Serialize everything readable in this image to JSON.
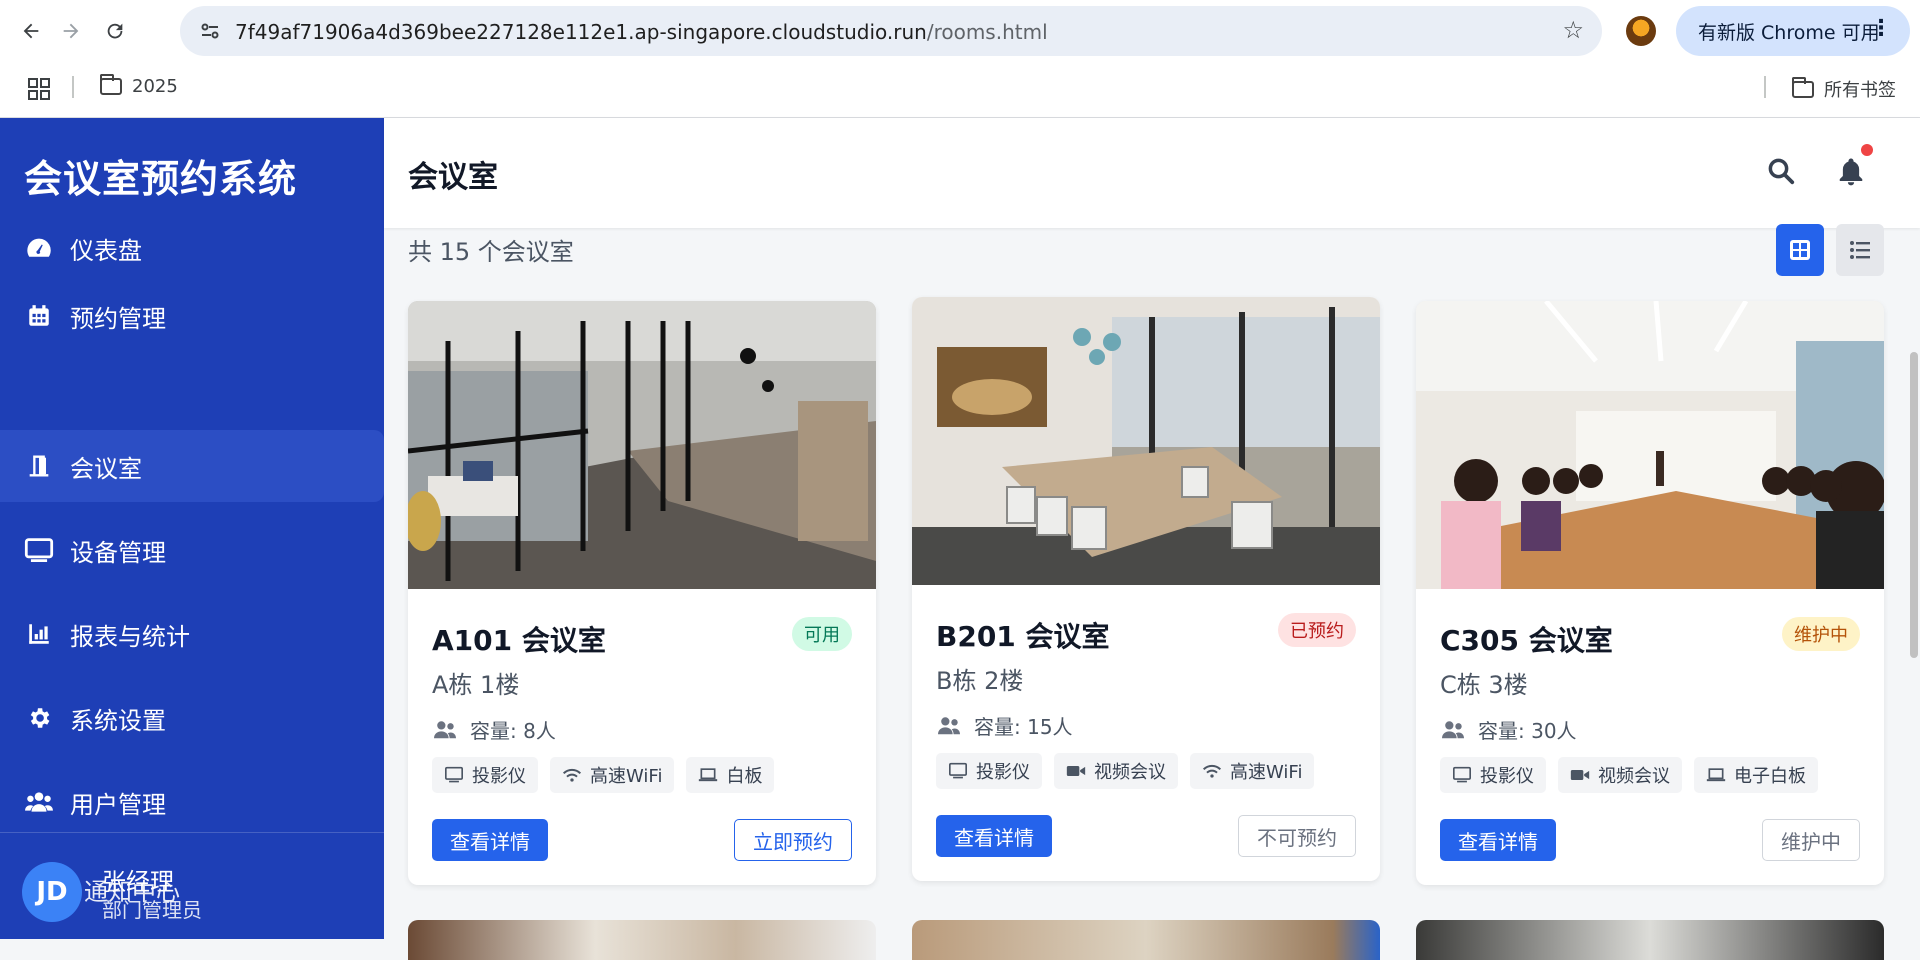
{
  "browser": {
    "url_main": "7f49af71906a4d369bee227128e112e1.ap-singapore.cloudstudio.run",
    "url_path": "/rooms.html",
    "update_label": "有新版 Chrome 可用",
    "bookmark_folder": "2025",
    "all_bookmarks": "所有书签"
  },
  "sidebar": {
    "brand": "会议室预约系统",
    "items": [
      {
        "label": "仪表盘",
        "icon": "gauge-icon"
      },
      {
        "label": "预约管理",
        "icon": "calendar-icon"
      },
      {
        "label": "会议室",
        "icon": "door-icon"
      },
      {
        "label": "设备管理",
        "icon": "monitor-icon"
      },
      {
        "label": "报表与统计",
        "icon": "bar-chart-icon"
      },
      {
        "label": "系统设置",
        "icon": "gear-icon"
      },
      {
        "label": "用户管理",
        "icon": "users-icon"
      }
    ],
    "active_index": 2,
    "user": {
      "initials": "JD",
      "name": "张经理",
      "role": "部门管理员",
      "overlap_text": "通知中心"
    }
  },
  "header": {
    "title": "会议室"
  },
  "main": {
    "count_text": "共 15 个会议室",
    "rooms": [
      {
        "title": "A101 会议室",
        "status": "可用",
        "location": "A栋 1楼",
        "capacity": "容量: 8人",
        "features": [
          {
            "label": "投影仪",
            "icon": "monitor-icon"
          },
          {
            "label": "高速WiFi",
            "icon": "wifi-icon"
          },
          {
            "label": "白板",
            "icon": "laptop-icon"
          }
        ],
        "detail_label": "查看详情",
        "action_label": "立即预约"
      },
      {
        "title": "B201 会议室",
        "status": "已预约",
        "location": "B栋 2楼",
        "capacity": "容量: 15人",
        "features": [
          {
            "label": "投影仪",
            "icon": "monitor-icon"
          },
          {
            "label": "视频会议",
            "icon": "video-icon"
          },
          {
            "label": "高速WiFi",
            "icon": "wifi-icon"
          }
        ],
        "detail_label": "查看详情",
        "action_label": "不可预约"
      },
      {
        "title": "C305 会议室",
        "status": "维护中",
        "location": "C栋 3楼",
        "capacity": "容量: 30人",
        "features": [
          {
            "label": "投影仪",
            "icon": "monitor-icon"
          },
          {
            "label": "视频会议",
            "icon": "video-icon"
          },
          {
            "label": "电子白板",
            "icon": "laptop-icon"
          }
        ],
        "detail_label": "查看详情",
        "action_label": "维护中"
      }
    ]
  },
  "colors": {
    "sidebar": "#1e3fb6",
    "primary": "#2563eb",
    "ok_bg": "#d1fae5",
    "booked_bg": "#fee2e2",
    "maint_bg": "#fef3c7"
  }
}
